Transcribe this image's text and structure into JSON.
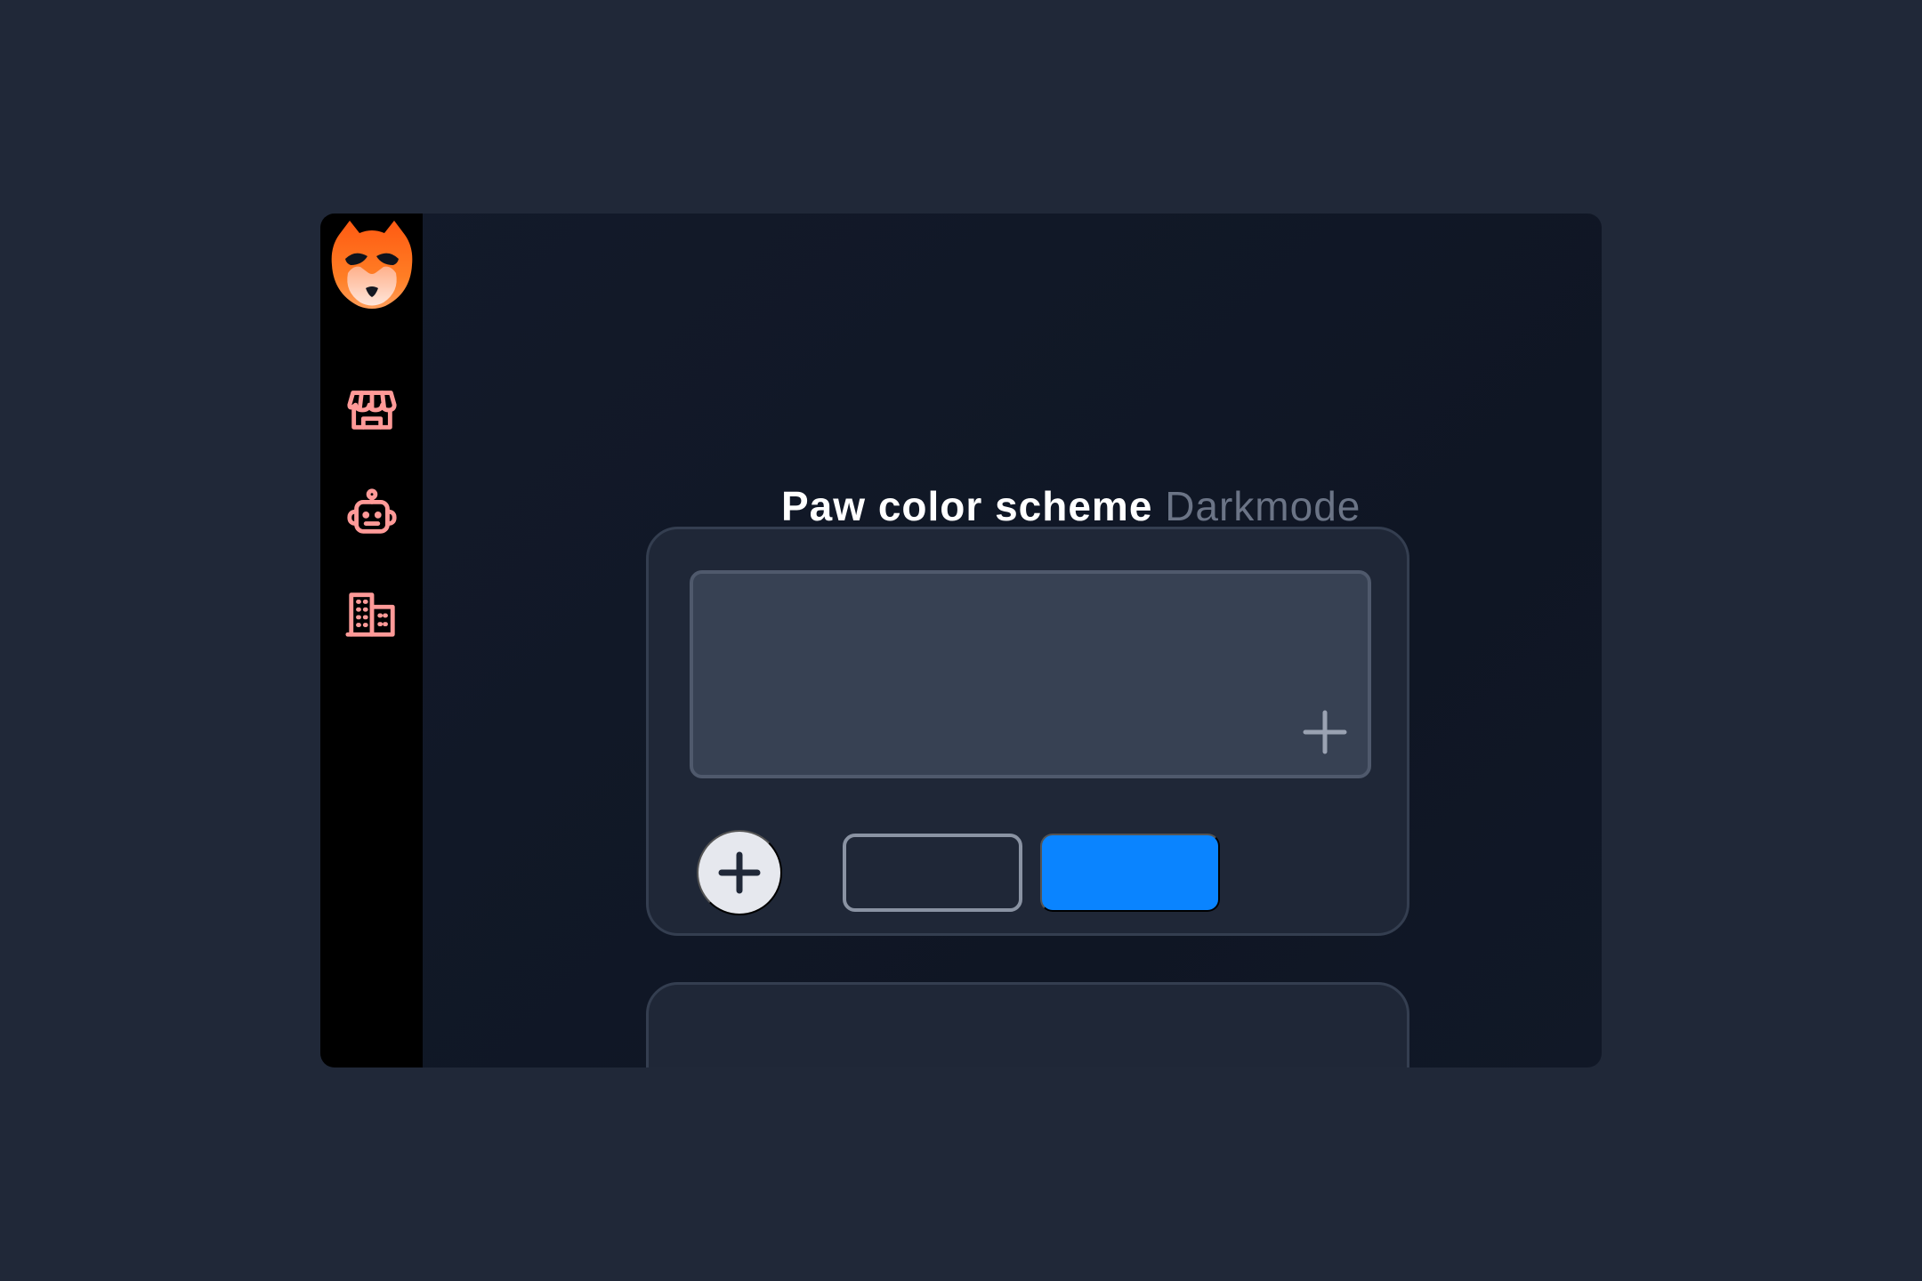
{
  "page": {
    "background_color": "#202838"
  },
  "window": {
    "background_color": "#111827",
    "sidebar_color": "#000000"
  },
  "sidebar": {
    "logo": {
      "icon": "fox-face-icon",
      "colors": [
        "#ff6a1a",
        "#ffd8c8"
      ]
    },
    "items": [
      {
        "icon": "storefront-icon",
        "color": "#ff9a98"
      },
      {
        "icon": "robot-icon",
        "color": "#ff9a98"
      },
      {
        "icon": "building-icon",
        "color": "#ff9a98"
      }
    ]
  },
  "section": {
    "title_strong": "Paw color scheme",
    "title_subtle": "Darkmode"
  },
  "card": {
    "editor_color": "#374153",
    "buttons": [
      {
        "type": "add-circle",
        "icon": "plus-icon",
        "color": "#e6e8ee"
      },
      {
        "type": "outline",
        "color": "#8a93a3"
      },
      {
        "type": "primary",
        "color": "#0a84ff"
      }
    ]
  }
}
